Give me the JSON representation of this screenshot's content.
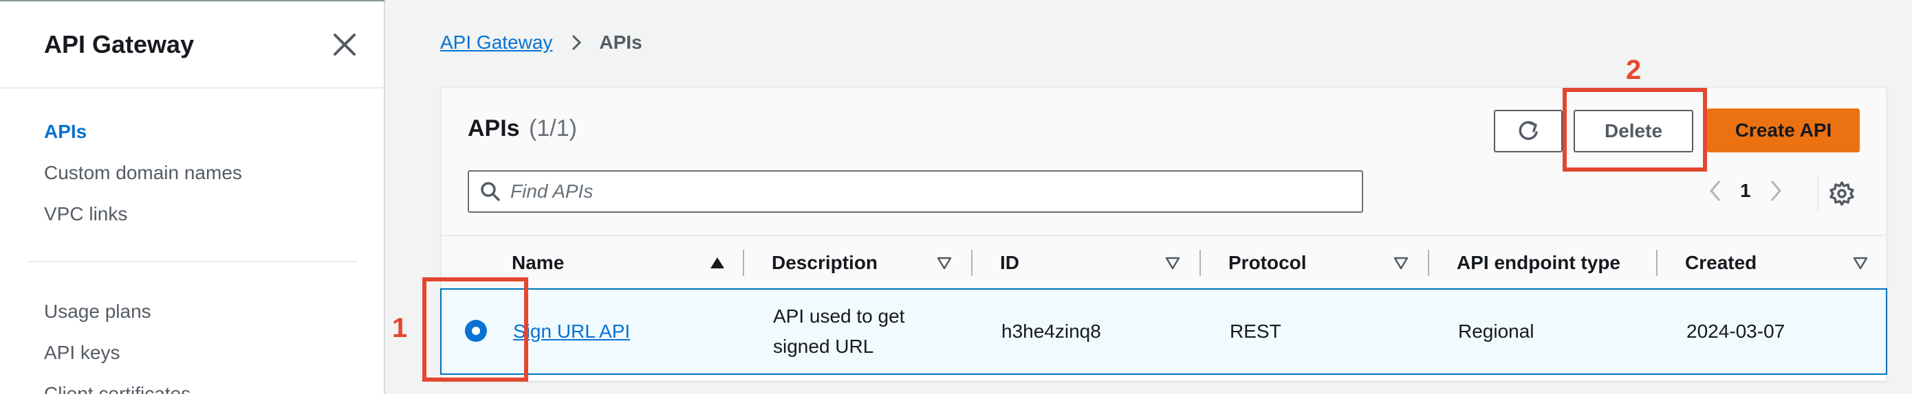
{
  "sidebar": {
    "title": "API Gateway",
    "items": [
      {
        "label": "APIs",
        "active": true
      },
      {
        "label": "Custom domain names"
      },
      {
        "label": "VPC links"
      },
      {
        "label": "Usage plans"
      },
      {
        "label": "API keys"
      },
      {
        "label": "Client certificates"
      }
    ]
  },
  "breadcrumb": {
    "root": "API Gateway",
    "current": "APIs"
  },
  "panel": {
    "title": "APIs",
    "count": "(1/1)",
    "buttons": {
      "refresh_icon": "refresh-icon",
      "delete": "Delete",
      "create": "Create API"
    },
    "search": {
      "placeholder": "Find APIs",
      "value": ""
    },
    "pagination": {
      "page": "1"
    }
  },
  "table": {
    "columns": [
      "Name",
      "Description",
      "ID",
      "Protocol",
      "API endpoint type",
      "Created"
    ],
    "rows": [
      {
        "selected": true,
        "name": "Sign URL API",
        "description_line1": "API used to get",
        "description_line2": "signed URL",
        "id": "h3he4zinq8",
        "protocol": "REST",
        "endpoint_type": "Regional",
        "created": "2024-03-07"
      }
    ]
  },
  "annotations": {
    "one": "1",
    "two": "2"
  },
  "colors": {
    "accent": "#0972d3",
    "primary_button": "#ec7211",
    "annotation": "#e4472f"
  }
}
